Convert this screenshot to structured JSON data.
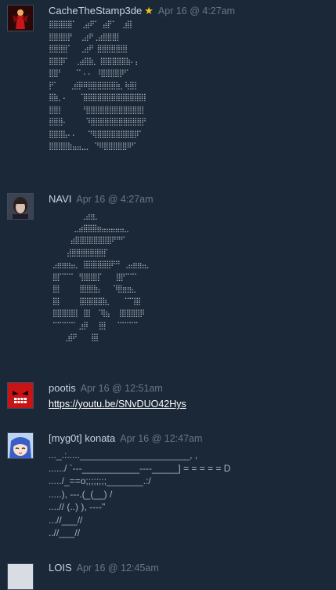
{
  "posts": [
    {
      "username": "CacheTheStamp3de",
      "badge": "★",
      "date": "Apr 16 @ 4:27am",
      "ascii": "⣿⣿⣿⣿⣿⠁ ⢀⣴⠟⠁ ⣴⡟⠁ ⢀⣾⡇\n⣿⣿⣿⣿⡟  ⢀⣴⠟⢀⣴⣿⣿⣿⡇\n⣿⣿⣿⣿⠁  ⢀⣴⠟ ⣿⣿⣿⣿⣿⣿⡇\n⣿⣿⣿⠏  ⢀⣴⣿⣷⡀⢸⣿⣿⣿⣿⣿⣷⠄⡄\n⣿⣿⠃   ⠈⠁⠄⠄ ⠸⣿⣿⣿⣿⡿⠋\n⡟⠁   ⢀⣾⡿⠿⣿⣿⣿⣿⣿⣿⣷⡀⢷⣿⡇\n⣿⣷⡀⠄   ⠈⣿⣿⣿⣿⣿⣿⣿⣿⣿⣿⣿⣿⣿⡇\n⣿⣿⡇     ⠘⣿⣿⣿⣿⣿⣿⣿⣿⣿⣿⣿⣿⡇\n⣿⣿⣿⠄     ⠹⣿⣿⣿⣿⣿⣿⣿⣿⣿⣿⣿⡟\n⣿⣿⣿⣧⠄⠄   ⠙⢿⣿⣿⣿⣿⣿⣿⣿⣿⡿⠁\n⣿⣿⣿⣿⣷⣤⣤⣀⡀ ⠙⠿⣿⣿⣿⣿⣿⠿⠋",
      "color": "#d42020"
    },
    {
      "username": "NAVI",
      "date": "Apr 16 @ 4:27am",
      "ascii": "         ⢀⣴⣶⡀\n       ⣀⣴⣿⣿⣿⣶⣤⣤⣤⣤⣤⣀\n      ⣴⣿⣿⣿⣿⣿⣿⣿⣿⠟⠛⠋\n     ⣼⣿⣿⣿⣿⣿⣿⣿⡏\n ⣠⣶⣶⣶⣤⡀ ⣿⣿⣿⣿⣿⣿⠟⠛ ⢀⣤⣶⣶⣤⡀\n ⣿⡏⠉⠉⠁ ⢻⣿⣿⣿⡏    ⣿⡟⠉⠉⠁\n ⣿⡇     ⣿⣿⣿⣷⡄   ⠹⣿⣶⣶⣄\n ⣿⡇     ⣿⣿⣿⣿⣿⣷⡀   ⠈⠉⢹⣿\n ⣿⣿⣿⣿⣿⡇ ⣿⡇ ⠈⢿⣦  ⢸⣿⣿⣿⣿⡿\n ⠉⠉⠉⠉⠉ ⣰⡿   ⣿⡇  ⠈⠉⠉⠉⠉\n    ⢀⣾⠟    ⣿⡇"
    },
    {
      "username": "pootis",
      "date": "Apr 16 @ 12:51am",
      "link": "https://youtu.be/SNvDUO42Hys"
    },
    {
      "username": "[myg0t] konata",
      "date": "Apr 16 @ 12:47am",
      "lines": [
        "..._.:....._____________________, ,",
        "....../ `---___________----_____] = = = = = D",
        "...../_==o;;;;;;;;_______.:/",
        ".....), ---.(_(__) /",
        "....// (..) ), ----\"",
        "...//___//",
        "..//___//"
      ]
    },
    {
      "username": "LOIS",
      "date": "Apr 16 @ 12:45am"
    }
  ]
}
